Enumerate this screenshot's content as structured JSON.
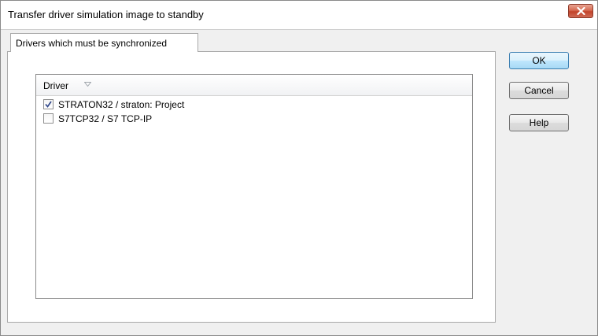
{
  "window": {
    "title": "Transfer driver simulation image to standby"
  },
  "tabs": [
    {
      "label": "Drivers which must be synchronized",
      "selected": true
    }
  ],
  "driver_list": {
    "column_header": "Driver",
    "rows": [
      {
        "label": "STRATON32 / straton: Project",
        "checked": true
      },
      {
        "label": "S7TCP32 / S7 TCP-IP",
        "checked": false
      }
    ]
  },
  "buttons": {
    "ok": "OK",
    "cancel": "Cancel",
    "help": "Help"
  },
  "icons": {
    "close": "close-icon",
    "sort": "sort-indicator-icon",
    "check": "check-icon"
  }
}
